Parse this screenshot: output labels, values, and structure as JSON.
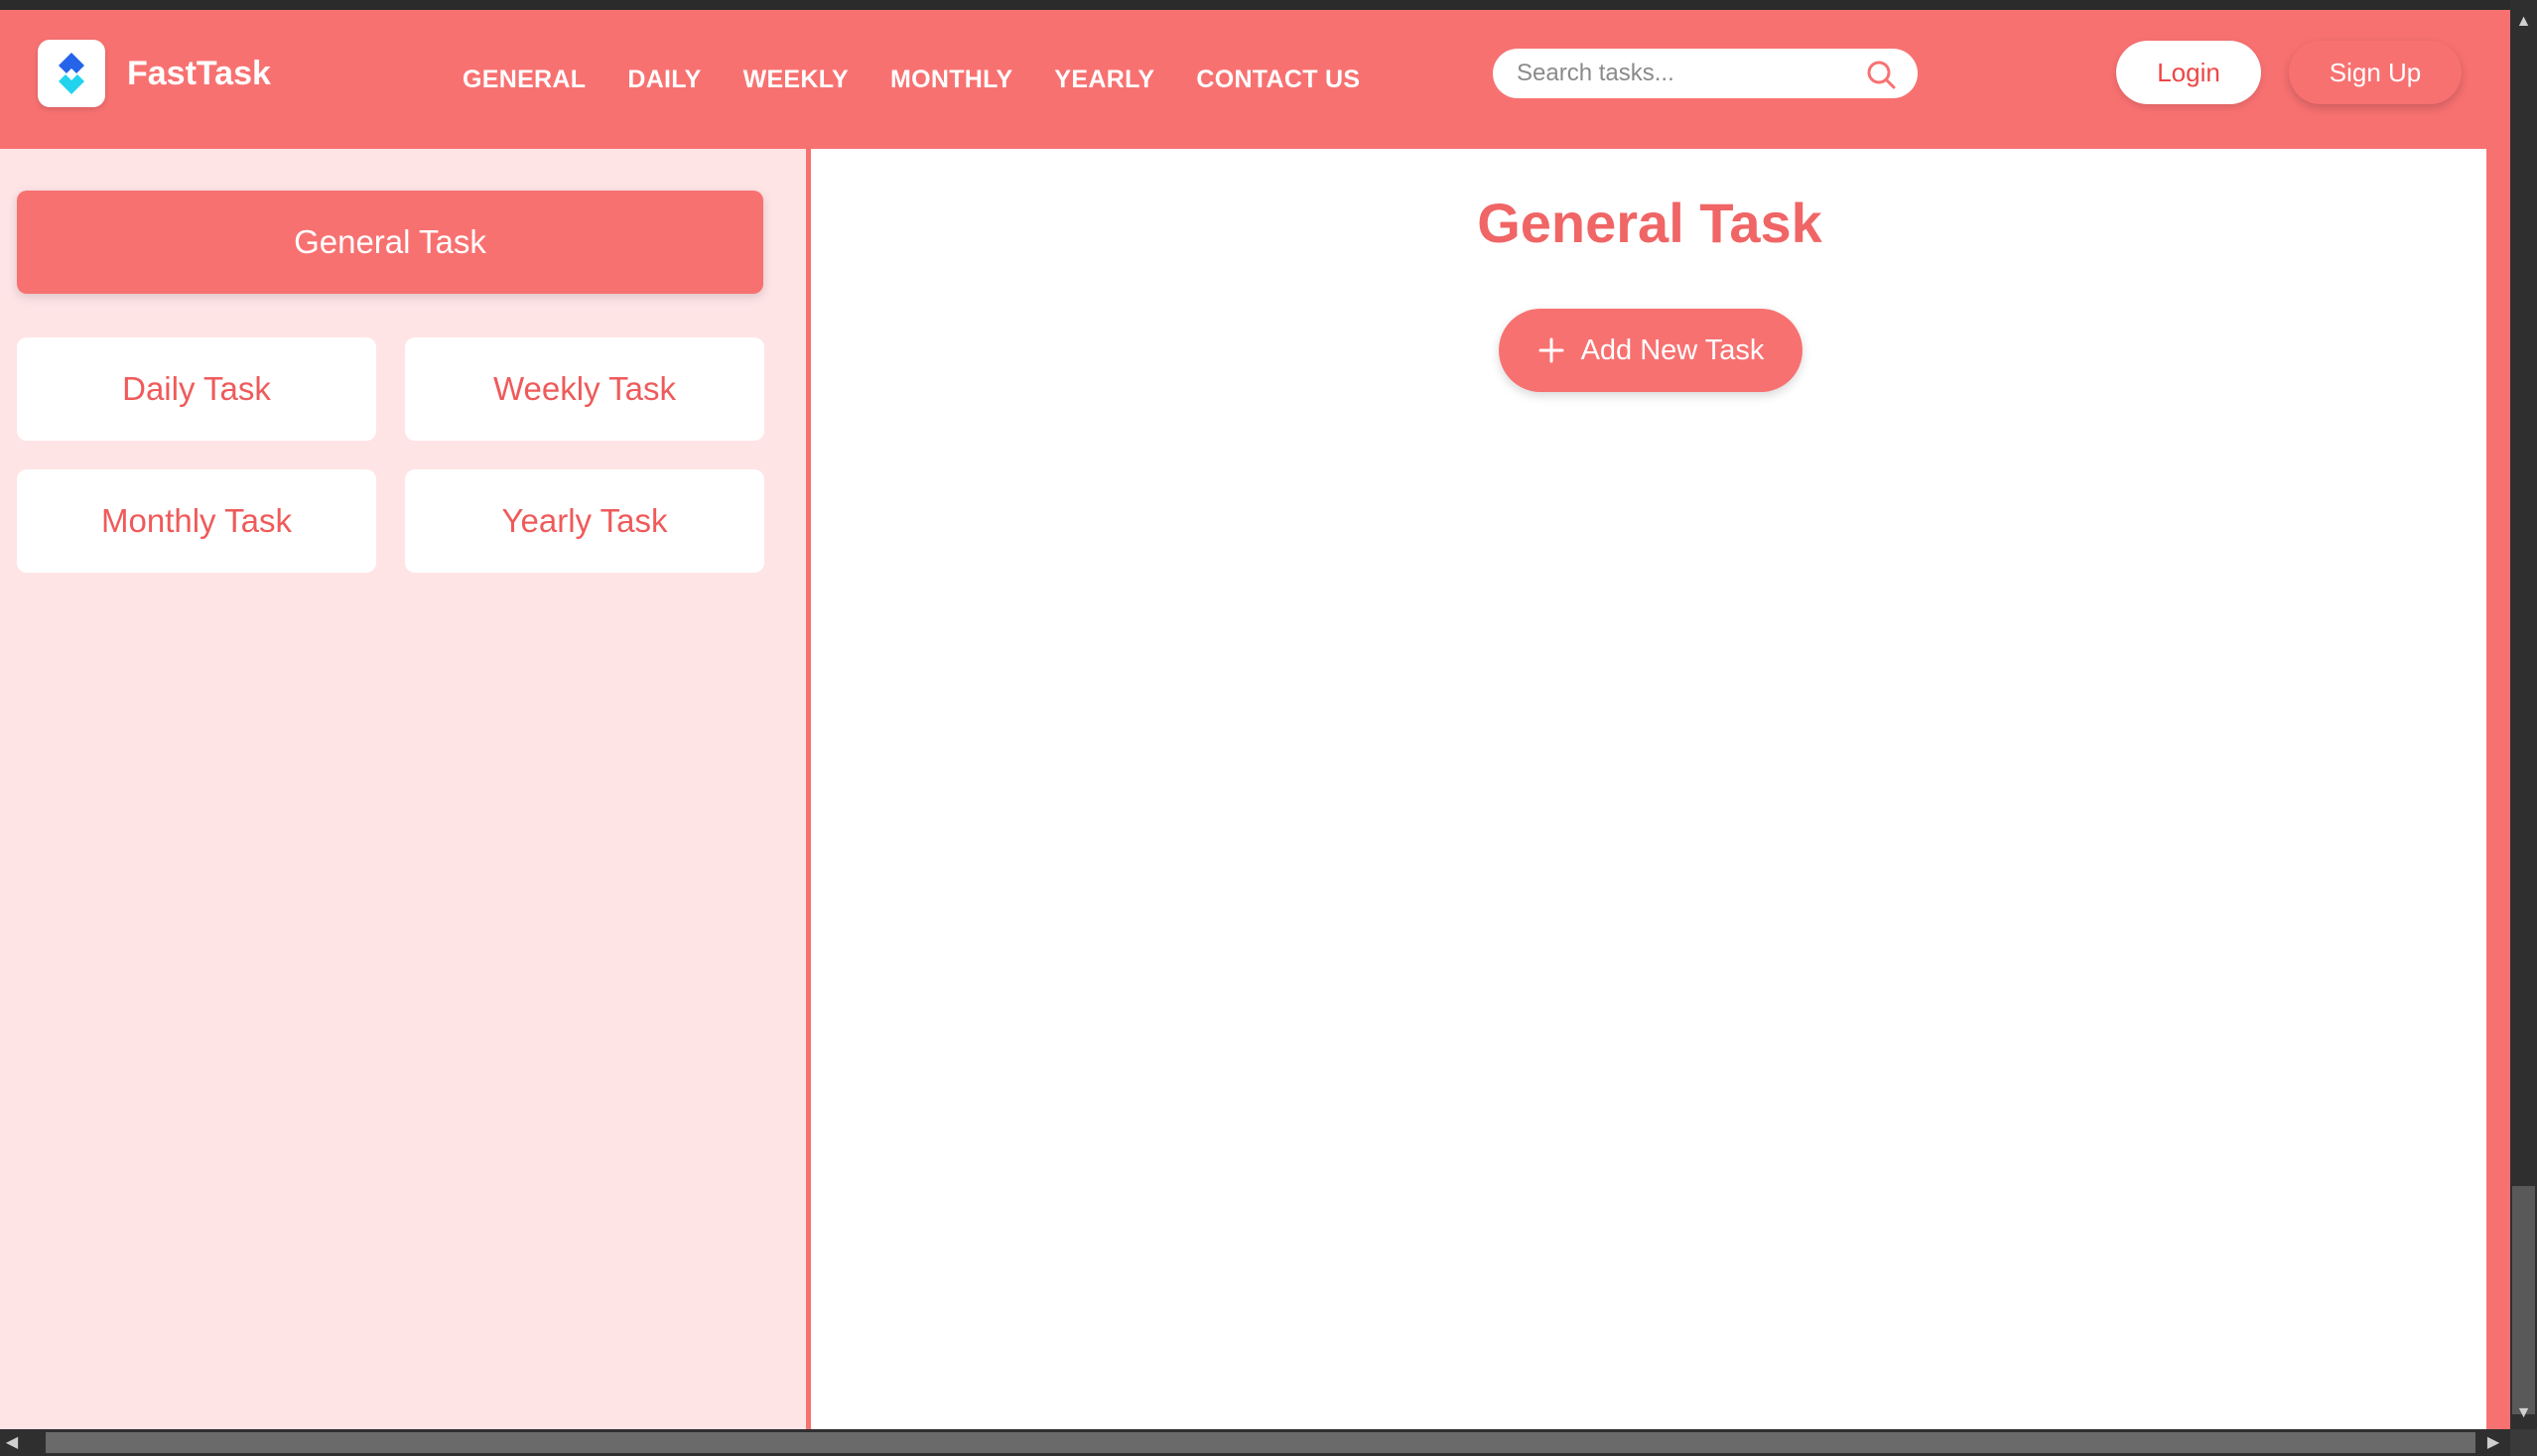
{
  "brand": {
    "name": "FastTask"
  },
  "nav": {
    "links": [
      "GENERAL",
      "DAILY",
      "WEEKLY",
      "MONTHLY",
      "YEARLY",
      "CONTACT US"
    ]
  },
  "search": {
    "placeholder": "Search tasks...",
    "icon": "search-icon"
  },
  "auth": {
    "login_label": "Login",
    "signup_label": "Sign Up"
  },
  "sidebar": {
    "active": "General Task",
    "items": [
      "Daily Task",
      "Weekly Task",
      "Monthly Task",
      "Yearly Task"
    ]
  },
  "main": {
    "title": "General Task",
    "add_button_label": "Add New Task",
    "add_icon": "plus-icon"
  },
  "colors": {
    "accent": "#f87171",
    "accent_text": "#ef5a5a",
    "sidebar_bg": "#ffe4e6",
    "white": "#ffffff"
  }
}
